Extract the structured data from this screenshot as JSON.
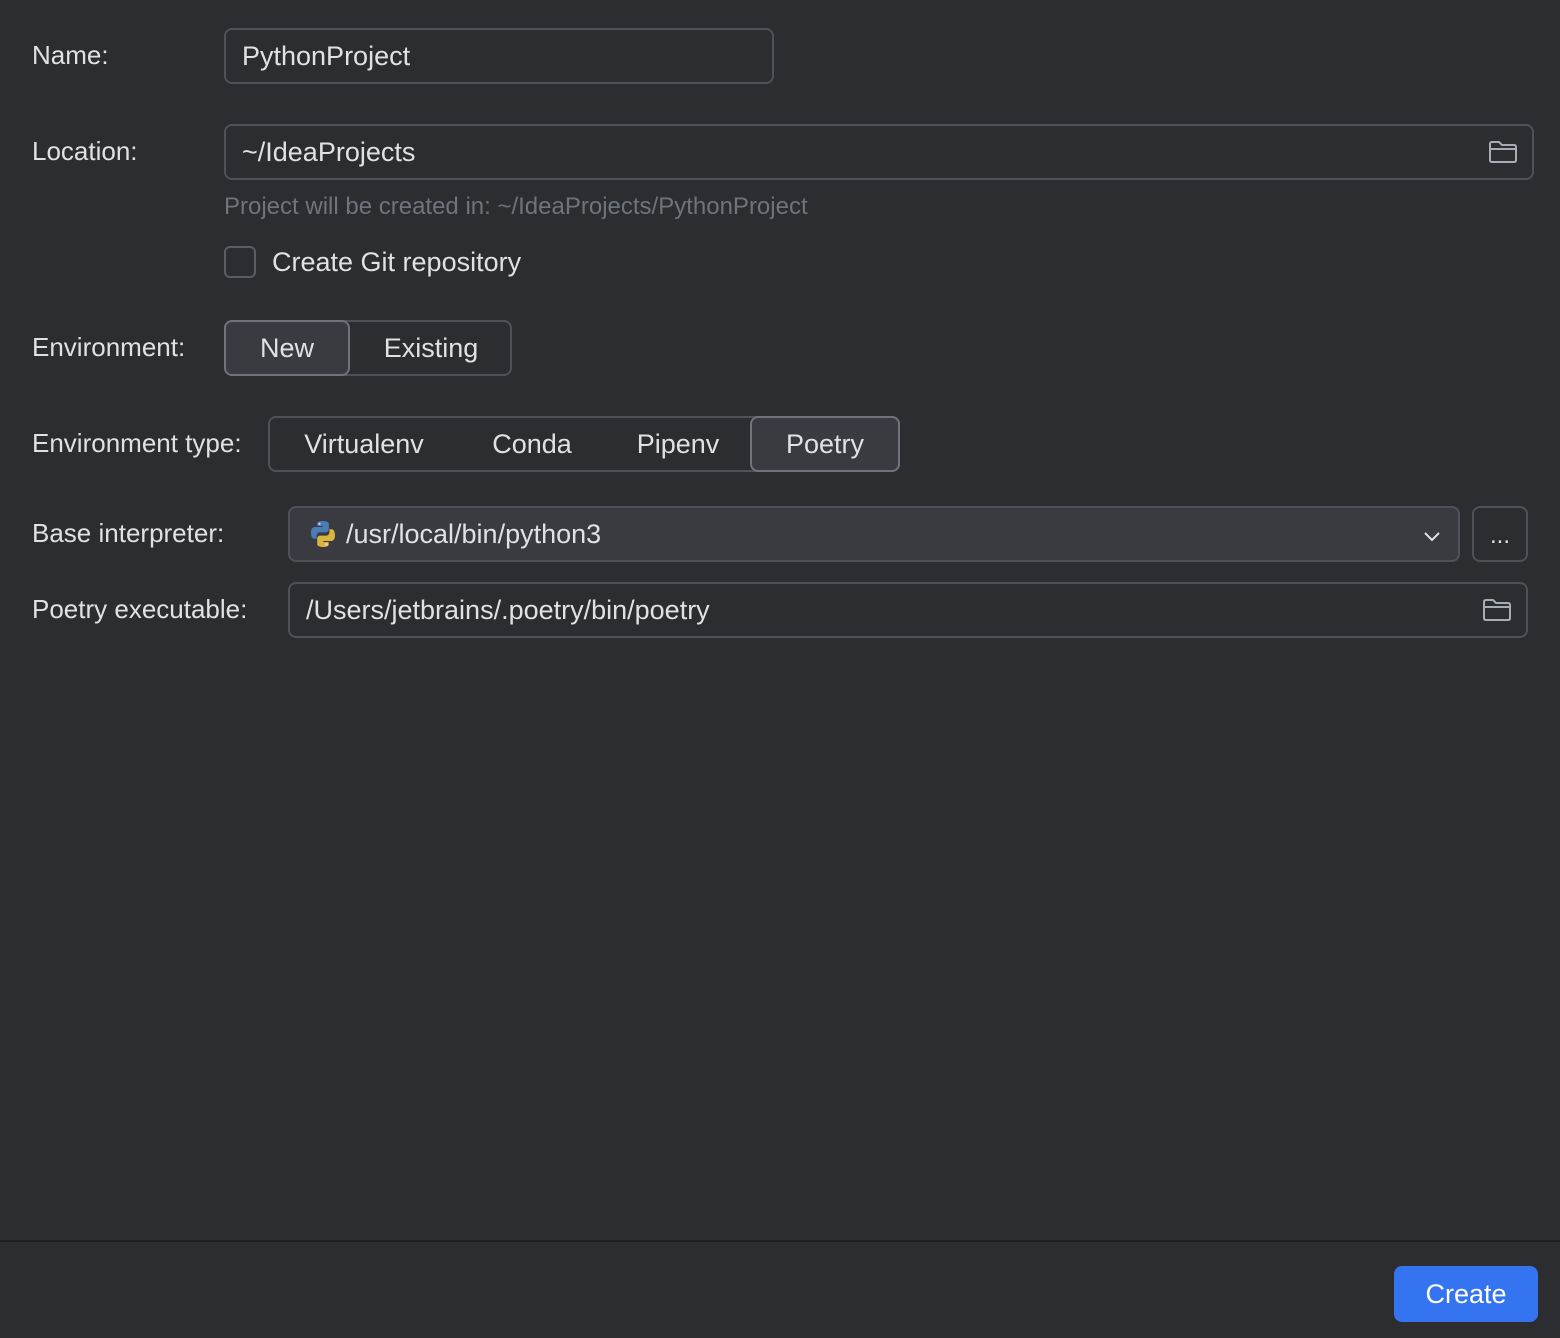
{
  "name": {
    "label": "Name:",
    "value": "PythonProject"
  },
  "location": {
    "label": "Location:",
    "value": "~/IdeaProjects",
    "icon": "folder-icon",
    "hint": "Project will be created in: ~/IdeaProjects/PythonProject"
  },
  "git": {
    "label": "Create Git repository",
    "checked": false
  },
  "environment": {
    "label": "Environment:",
    "options": [
      "New",
      "Existing"
    ],
    "selected": "New"
  },
  "environment_type": {
    "label": "Environment type:",
    "options": [
      "Virtualenv",
      "Conda",
      "Pipenv",
      "Poetry"
    ],
    "selected": "Poetry"
  },
  "base_interpreter": {
    "label": "Base interpreter:",
    "value": "/usr/local/bin/python3",
    "icon": "python-icon",
    "more_label": "..."
  },
  "poetry_executable": {
    "label": "Poetry executable:",
    "value": "/Users/jetbrains/.poetry/bin/poetry",
    "icon": "folder-icon"
  },
  "footer": {
    "create_label": "Create"
  },
  "colors": {
    "background": "#2b2d30",
    "accent": "#3574f0",
    "border": "#4e5157",
    "hint_text": "#6f737a"
  }
}
